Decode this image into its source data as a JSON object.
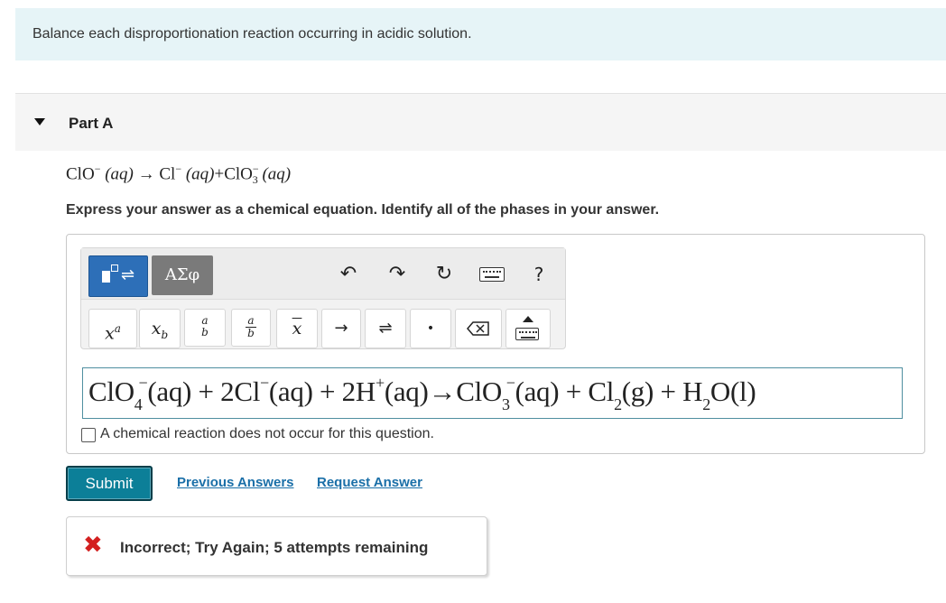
{
  "intro": {
    "text": "Balance each disproportionation reaction occurring in acidic solution."
  },
  "part": {
    "title": "Part A"
  },
  "reaction": {
    "reactant": "ClO",
    "reactant_charge": "−",
    "reactant_phase": "(aq)",
    "arrow": "→",
    "product1": "Cl",
    "product1_charge": "−",
    "product1_phase": "(aq)",
    "plus": "+",
    "product2": "ClO",
    "product2_sub": "3",
    "product2_charge": "−",
    "product2_phase": "(aq)"
  },
  "instructions": "Express your answer as a chemical equation. Identify all of the phases in your answer.",
  "toolbar": {
    "greek_label": "ΑΣφ",
    "help_label": "?",
    "superscript_base": "x",
    "superscript_exp": "a",
    "subscript_base": "x",
    "subscript_sub": "b",
    "stack_top": "a",
    "stack_bottom": "b",
    "fraction_top": "a",
    "fraction_bottom": "b",
    "bar_label": "x",
    "arrow_label": "→",
    "equilibrium_label": "⇌",
    "dot_label": "•"
  },
  "answer": {
    "p1": "ClO",
    "p1_sub": "4",
    "p1_sup": "−",
    "p2": "(aq) + 2Cl",
    "p2_sup": "−",
    "p3": "(aq) + 2H",
    "p3_sup": "+",
    "p4": "(aq)→ClO",
    "p4_sub": "3",
    "p4_sup": "−",
    "p5": "(aq) + Cl",
    "p5_sub": "2",
    "p6": "(g) + H",
    "p6_sub": "2",
    "p7": "O(l)"
  },
  "no_reaction_label": "A chemical reaction does not occur for this question.",
  "buttons": {
    "submit": "Submit",
    "previous_answers": "Previous Answers",
    "request_answer": "Request Answer"
  },
  "feedback": {
    "icon": "x-icon",
    "text": "Incorrect; Try Again; 5 attempts remaining",
    "color": "#d32020"
  },
  "colors": {
    "intro_bg": "#e6f4f7",
    "submit_bg": "#0c7f98",
    "link": "#1a6fa8",
    "template_button": "#2d6fb8"
  }
}
